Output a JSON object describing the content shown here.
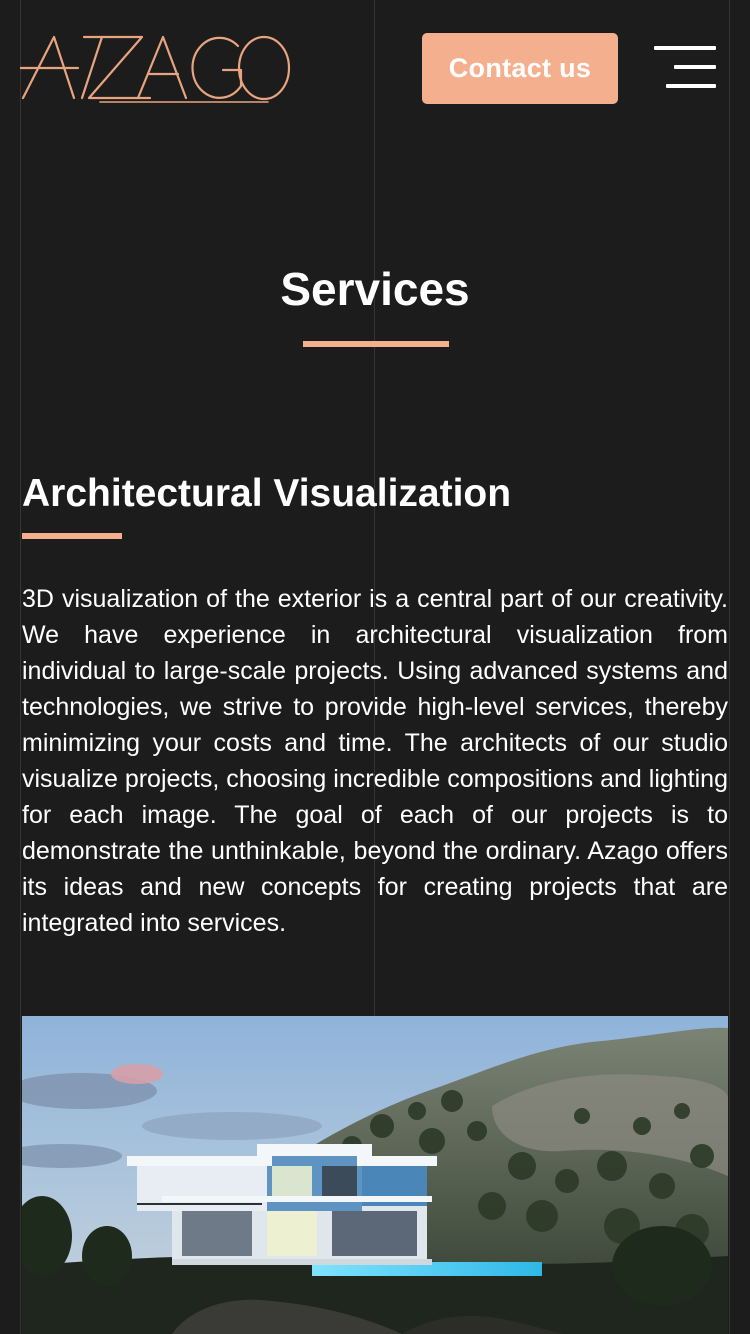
{
  "header": {
    "logo_text": "AZAGO",
    "contact_label": "Contact us"
  },
  "page": {
    "title": "Services"
  },
  "section": {
    "title": "Architectural Visualization",
    "body": "3D visualization of the exterior is a central part of our creativity. We have experience in architectural visualization from individual to large-scale projects. Using advanced systems and technologies, we strive to provide high-level services, thereby minimizing your costs and time. The architects of our studio visualize projects, choosing incredible compositions and lighting for each image. The goal of each of our projects is to demonstrate the unthinkable, beyond the ordinary. Azago offers its ideas and new concepts for creating projects that are integrated into services."
  },
  "colors": {
    "background": "#1c1c1c",
    "accent": "#f4b08e",
    "text": "#ffffff",
    "logo": "#e8a47f"
  },
  "icons": {
    "menu": "hamburger-menu-icon"
  }
}
